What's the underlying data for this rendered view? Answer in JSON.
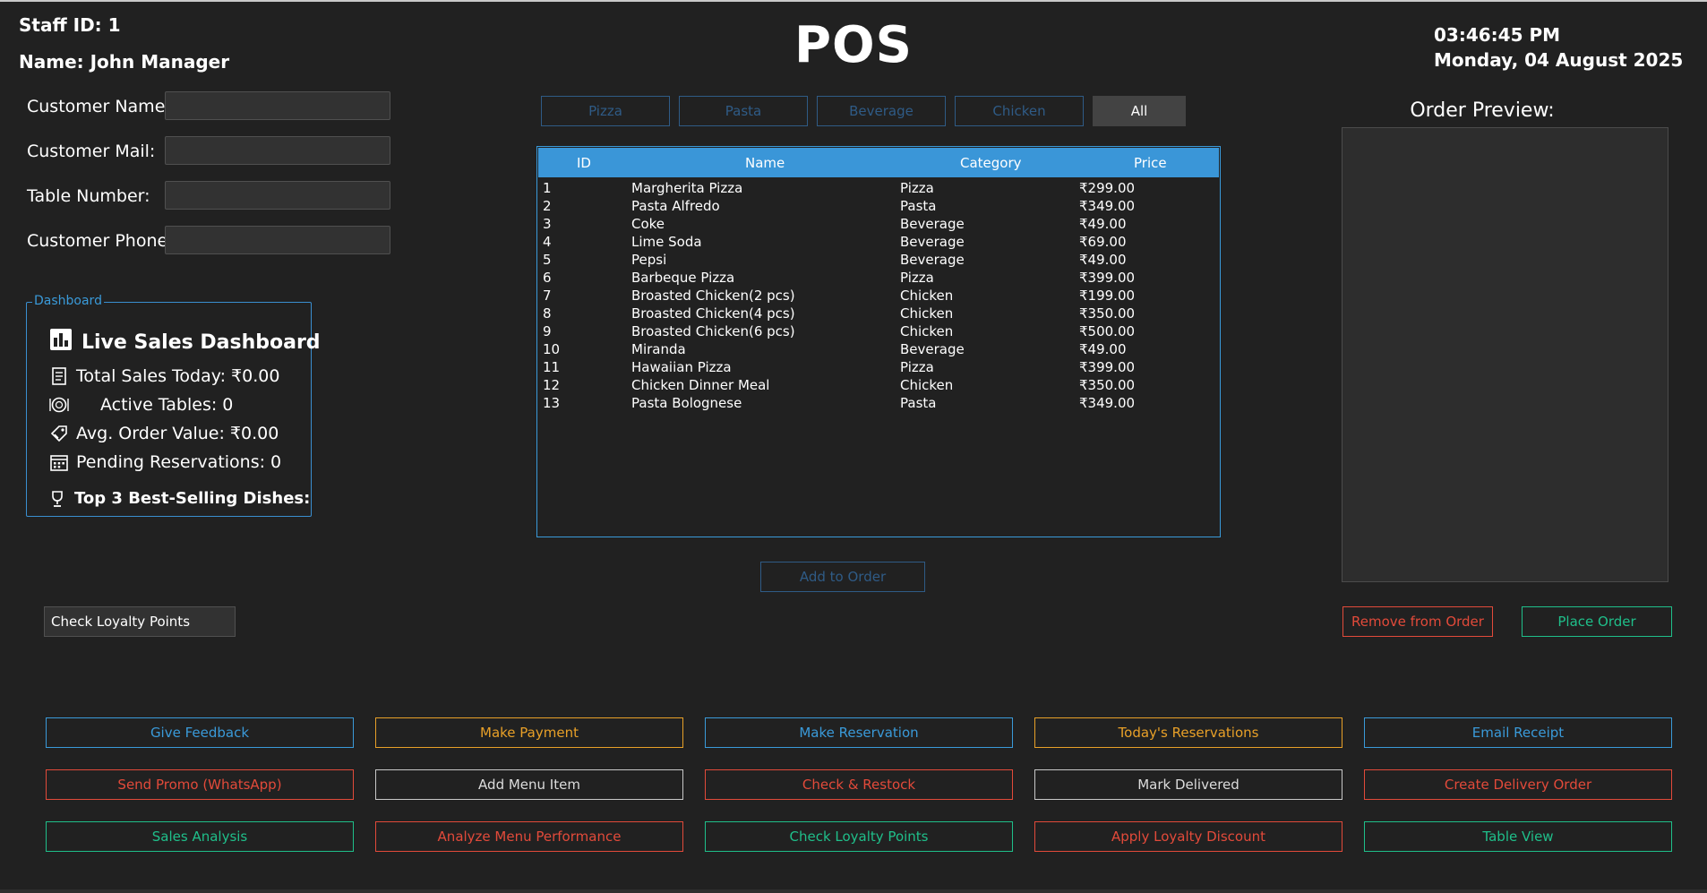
{
  "header": {
    "staff_id": "Staff ID: 1",
    "staff_name": "Name: John Manager",
    "title": "POS",
    "time": "03:46:45 PM",
    "date": "Monday, 04 August 2025"
  },
  "customer_form": {
    "name_label": "Customer Name:",
    "name_value": "",
    "mail_label": "Customer Mail:",
    "mail_value": "",
    "table_label": "Table Number:",
    "table_value": "",
    "phone_label": "Customer Phone:",
    "phone_value": ""
  },
  "dashboard": {
    "legend": "Dashboard",
    "heading": "Live Sales Dashboard",
    "total_sales": "Total Sales Today: ₹0.00",
    "active_tables": "Active Tables: 0",
    "avg_order": "Avg. Order Value: ₹0.00",
    "pending_reservations": "Pending Reservations: 0",
    "top_dishes": "Top 3 Best-Selling Dishes:"
  },
  "categories": {
    "pizza": "Pizza",
    "pasta": "Pasta",
    "beverage": "Beverage",
    "chicken": "Chicken",
    "all": "All",
    "selected": "All"
  },
  "menu": {
    "columns": {
      "id": "ID",
      "name": "Name",
      "category": "Category",
      "price": "Price"
    },
    "rows": [
      {
        "id": "1",
        "name": "Margherita Pizza",
        "category": "Pizza",
        "price": "₹299.00"
      },
      {
        "id": "2",
        "name": "Pasta Alfredo",
        "category": "Pasta",
        "price": "₹349.00"
      },
      {
        "id": "3",
        "name": "Coke",
        "category": "Beverage",
        "price": "₹49.00"
      },
      {
        "id": "4",
        "name": "Lime Soda",
        "category": "Beverage",
        "price": "₹69.00"
      },
      {
        "id": "5",
        "name": "Pepsi",
        "category": "Beverage",
        "price": "₹49.00"
      },
      {
        "id": "6",
        "name": "Barbeque Pizza",
        "category": "Pizza",
        "price": "₹399.00"
      },
      {
        "id": "7",
        "name": "Broasted Chicken(2 pcs)",
        "category": "Chicken",
        "price": "₹199.00"
      },
      {
        "id": "8",
        "name": "Broasted Chicken(4 pcs)",
        "category": "Chicken",
        "price": "₹350.00"
      },
      {
        "id": "9",
        "name": "Broasted Chicken(6 pcs)",
        "category": "Chicken",
        "price": "₹500.00"
      },
      {
        "id": "10",
        "name": "Miranda",
        "category": "Beverage",
        "price": "₹49.00"
      },
      {
        "id": "11",
        "name": "Hawaiian Pizza",
        "category": "Pizza",
        "price": "₹399.00"
      },
      {
        "id": "12",
        "name": "Chicken Dinner Meal",
        "category": "Chicken",
        "price": "₹350.00"
      },
      {
        "id": "13",
        "name": "Pasta Bolognese",
        "category": "Pasta",
        "price": "₹349.00"
      }
    ],
    "add_button": "Add to Order"
  },
  "order_preview": {
    "title": "Order Preview:",
    "remove_button": "Remove from Order",
    "place_button": "Place Order"
  },
  "loyalty_small_button": "Check Loyalty Points",
  "actions": {
    "give_feedback": "Give Feedback",
    "make_payment": "Make Payment",
    "make_reservation": "Make Reservation",
    "todays_reservations": "Today's Reservations",
    "email_receipt": "Email Receipt",
    "send_promo": "Send Promo (WhatsApp)",
    "add_menu_item": "Add Menu Item",
    "check_restock": "Check & Restock",
    "mark_delivered": "Mark Delivered",
    "create_delivery": "Create Delivery Order",
    "sales_analysis": "Sales Analysis",
    "analyze_menu": "Analyze Menu Performance",
    "check_loyalty": "Check Loyalty Points",
    "apply_loyalty": "Apply Loyalty Discount",
    "table_view": "Table View"
  },
  "colors": {
    "background": "#212121",
    "accent_blue": "#3a9ad9",
    "orange": "#e8a028",
    "red": "#e24a3a",
    "green": "#1fbf8a"
  },
  "icons": {
    "dashboard": "bar-chart-icon",
    "sales": "receipt-icon",
    "tables": "plate-icon",
    "avg": "tag-icon",
    "reservations": "calendar-icon",
    "best": "trophy-icon"
  }
}
